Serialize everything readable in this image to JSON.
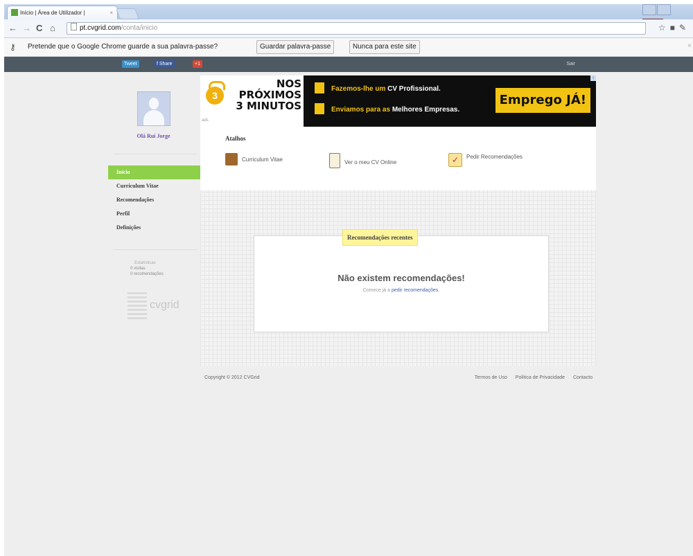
{
  "browser": {
    "tab_title": "Início | Área de Utilizador |",
    "tab_close": "×",
    "url_host": "pt.cvgrid.com",
    "url_path": "/conta/inicio",
    "nav": {
      "back": "←",
      "forward": "→",
      "reload": "C",
      "home": "⌂"
    }
  },
  "password_bar": {
    "message": "Pretende que o Google Chrome guarde a sua palavra-passe?",
    "save_button": "Guardar palavra-passe",
    "never_button": "Nunca para este site"
  },
  "site_bar": {
    "tweet": "Tweet",
    "share": "f Share",
    "gplus": "+1",
    "exit": "Sair"
  },
  "sidebar": {
    "user_name": "Olá Rui Jorge",
    "items": [
      {
        "label": "Início",
        "active": true
      },
      {
        "label": "Curriculum Vitae"
      },
      {
        "label": "Recomendações"
      },
      {
        "label": "Perfil"
      },
      {
        "label": "Definições"
      }
    ],
    "stats": {
      "title": "Estatísticas",
      "views": "0 visitas",
      "recs": "0 recomendações"
    },
    "logo_text": "cvgrid"
  },
  "banner": {
    "headline": [
      "NOS",
      "PRÓXIMOS",
      "3 MINUTOS"
    ],
    "medal_number": "3",
    "line1_prefix": "Fazemos-lhe um ",
    "line1_strong": "CV Profissional.",
    "line2_prefix": "Enviamos para as ",
    "line2_strong": "Melhores Empresas.",
    "cta": "Emprego JÁ!",
    "ad_tag": "ads"
  },
  "shortcuts": {
    "title": "Atalhos",
    "items": [
      {
        "label": "Curriculum Vitae",
        "icon": "briefcase-icon"
      },
      {
        "label": "Ver o meu CV Online",
        "icon": "clipboard-icon"
      },
      {
        "label": "Pedir Recomendações",
        "icon": "checkmark-icon"
      }
    ]
  },
  "recent": {
    "tab": "Recomendações recentes",
    "empty_title": "Não existem recomendações!",
    "empty_prefix": "Comece já a ",
    "empty_link": "pedir recomendações",
    "empty_suffix": "."
  },
  "footer": {
    "copyright": "Copyright © 2012 CVGrid",
    "links": [
      "Termos de Uso",
      "Política de Privacidade",
      "Contacto"
    ]
  },
  "colors": {
    "accent_green": "#8ed04a",
    "banner_yellow": "#f2c313",
    "sitebar": "#4d5963"
  }
}
